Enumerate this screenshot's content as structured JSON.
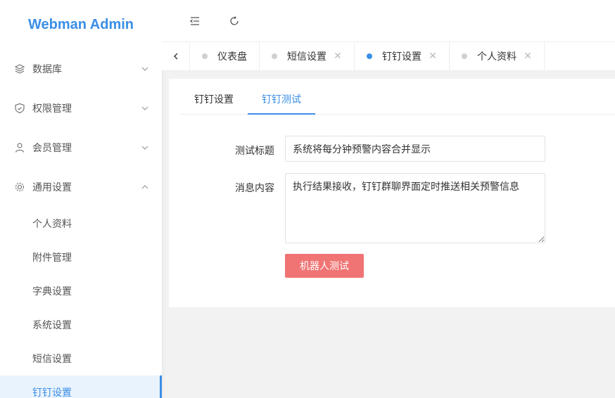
{
  "app": {
    "title": "Webman Admin"
  },
  "sidebar": {
    "groups": [
      {
        "label": "数据库",
        "icon": "layers-icon"
      },
      {
        "label": "权限管理",
        "icon": "shield-check-icon"
      },
      {
        "label": "会员管理",
        "icon": "user-icon"
      },
      {
        "label": "通用设置",
        "icon": "gear-icon"
      }
    ],
    "sub_items": [
      {
        "label": "个人资料"
      },
      {
        "label": "附件管理"
      },
      {
        "label": "字典设置"
      },
      {
        "label": "系统设置"
      },
      {
        "label": "短信设置"
      },
      {
        "label": "钉钉设置"
      }
    ]
  },
  "header": {
    "collapse_icon": "indent-icon",
    "refresh_icon": "refresh-icon"
  },
  "tabs": [
    {
      "label": "仪表盘"
    },
    {
      "label": "短信设置"
    },
    {
      "label": "钉钉设置"
    },
    {
      "label": "个人资料"
    }
  ],
  "content": {
    "subtabs": [
      {
        "label": "钉钉设置"
      },
      {
        "label": "钉钉测试"
      }
    ],
    "form": {
      "title_label": "测试标题",
      "title_value": "系统将每分钟预警内容合并显示",
      "message_label": "消息内容",
      "message_value": "执行结果接收，钉钉群聊界面定时推送相关预警信息",
      "submit_label": "机器人测试"
    }
  },
  "colors": {
    "accent": "#3a8ee6",
    "button": "#f07474",
    "active_bg": "#e9f3fd"
  }
}
